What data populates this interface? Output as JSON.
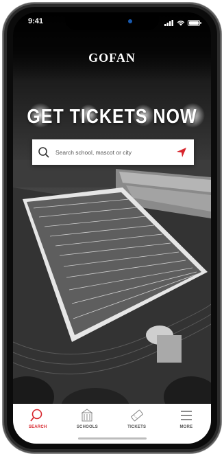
{
  "status": {
    "time": "9:41"
  },
  "brand": {
    "logo_text": "GOFAN"
  },
  "hero": {
    "headline": "GET TICKETS NOW"
  },
  "search": {
    "placeholder": "Search school, mascot or city"
  },
  "tabs": [
    {
      "label": "SEARCH",
      "icon": "search-icon",
      "active": true
    },
    {
      "label": "SCHOOLS",
      "icon": "school-building-icon",
      "active": false
    },
    {
      "label": "TICKETS",
      "icon": "ticket-icon",
      "active": false
    },
    {
      "label": "MORE",
      "icon": "menu-icon",
      "active": false
    }
  ],
  "colors": {
    "accent": "#d7262d",
    "tab_inactive": "#555555"
  }
}
